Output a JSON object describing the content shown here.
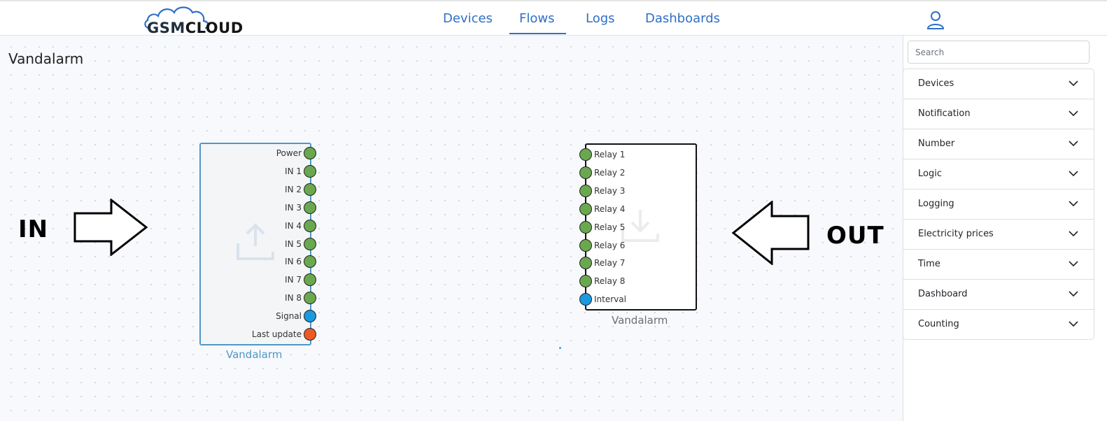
{
  "header": {
    "logo": {
      "part1": "GSM",
      "part2": "CLOUD"
    },
    "nav": [
      "Devices",
      "Flows",
      "Logs",
      "Dashboards"
    ],
    "active_nav": "Flows",
    "user_icon": "user-icon",
    "accent_color": "#2f6fc6"
  },
  "flow": {
    "title": "Vandalarm",
    "annotations": {
      "in_label": "IN",
      "out_label": "OUT"
    },
    "input_node": {
      "caption": "Vandalarm",
      "icon": "upload-icon",
      "ports": [
        {
          "label": "Power",
          "color": "green"
        },
        {
          "label": "IN 1",
          "color": "green"
        },
        {
          "label": "IN 2",
          "color": "green"
        },
        {
          "label": "IN 3",
          "color": "green"
        },
        {
          "label": "IN 4",
          "color": "green"
        },
        {
          "label": "IN 5",
          "color": "green"
        },
        {
          "label": "IN 6",
          "color": "green"
        },
        {
          "label": "IN 7",
          "color": "green"
        },
        {
          "label": "IN 8",
          "color": "green"
        },
        {
          "label": "Signal",
          "color": "blue"
        },
        {
          "label": "Last update",
          "color": "red"
        }
      ]
    },
    "output_node": {
      "caption": "Vandalarm",
      "icon": "download-icon",
      "ports": [
        {
          "label": "Relay 1",
          "color": "green"
        },
        {
          "label": "Relay 2",
          "color": "green"
        },
        {
          "label": "Relay 3",
          "color": "green"
        },
        {
          "label": "Relay 4",
          "color": "green"
        },
        {
          "label": "Relay 5",
          "color": "green"
        },
        {
          "label": "Relay 6",
          "color": "green"
        },
        {
          "label": "Relay 7",
          "color": "green"
        },
        {
          "label": "Relay 8",
          "color": "green"
        },
        {
          "label": "Interval",
          "color": "blue"
        }
      ]
    }
  },
  "sidebar": {
    "search": {
      "placeholder": "Search",
      "value": ""
    },
    "categories": [
      "Devices",
      "Notification",
      "Number",
      "Logic",
      "Logging",
      "Electricity prices",
      "Time",
      "Dashboard",
      "Counting"
    ]
  }
}
